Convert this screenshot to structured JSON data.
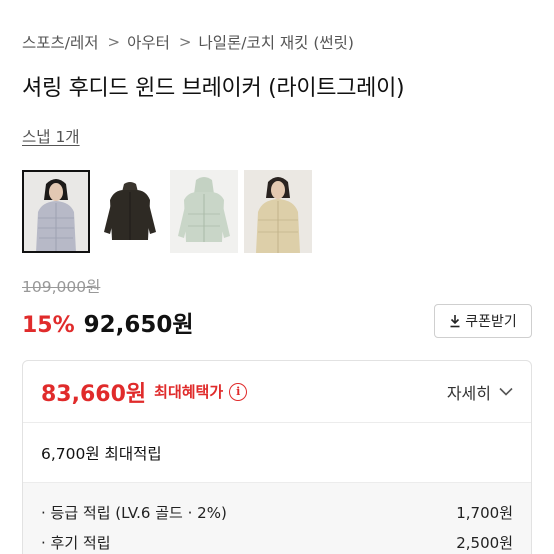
{
  "breadcrumb": {
    "items": [
      "스포츠/레저",
      "아우터",
      "나일론/코치 재킷 (썬릿)"
    ],
    "separator": ">"
  },
  "product": {
    "title": "셔링 후디드 윈드 브레이커 (라이트그레이)",
    "brand": "스냅 1개"
  },
  "thumbnails": [
    {
      "name": "라이트그레이",
      "color": "#b7b9c7",
      "selected": true
    },
    {
      "name": "블랙",
      "color": "#2e2a24",
      "selected": false
    },
    {
      "name": "민트",
      "color": "#c9d6c8",
      "selected": false
    },
    {
      "name": "베이지",
      "color": "#ddcfa9",
      "selected": false
    }
  ],
  "price": {
    "original": "109,000원",
    "discount": "15%",
    "sale": "92,650원",
    "coupon_label": "쿠폰받기"
  },
  "benefit": {
    "price": "83,660원",
    "label": "최대혜택가",
    "info_glyph": "i",
    "detail_label": "자세히",
    "max_points": "6,700원 최대적립",
    "points": [
      {
        "label": "· 등급 적립 (LV.6 골드 · 2%)",
        "value": "1,700원"
      },
      {
        "label": "· 후기 적립",
        "value": "2,500원"
      }
    ]
  },
  "colors": {
    "accent_red": "#e02b2b",
    "text_primary": "#111111",
    "text_secondary": "#555555",
    "border": "#e2e2e2"
  }
}
